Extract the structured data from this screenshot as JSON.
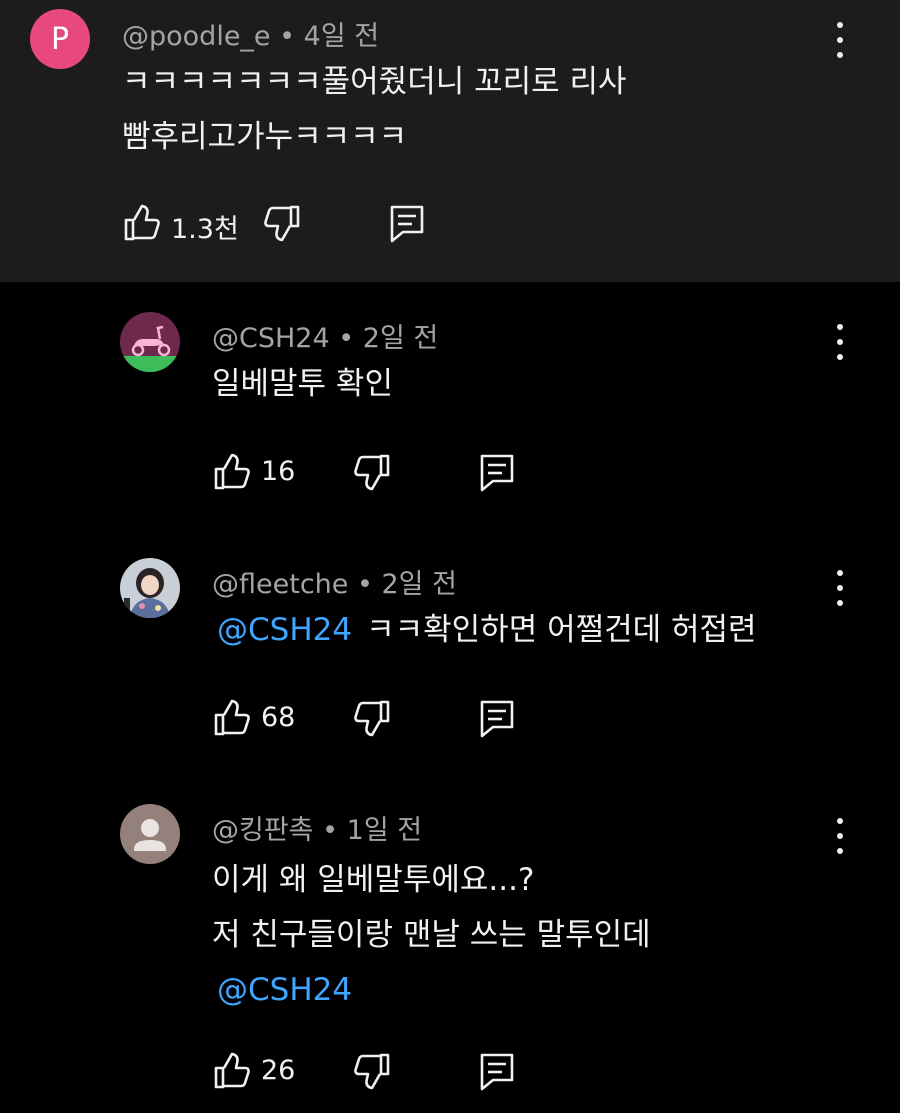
{
  "comments": [
    {
      "handle": "@poodle_e",
      "age": "4일 전",
      "avatar_letter": "P",
      "lines": [
        "ㅋㅋㅋㅋㅋㅋㅋ풀어줬더니 꼬리로 리사",
        "빰후리고가누ㅋㅋㅋㅋ"
      ],
      "likes": "1.3천"
    },
    {
      "handle": "@CSH24",
      "age": "2일 전",
      "lines": [
        "일베말투 확인"
      ],
      "likes": "16"
    },
    {
      "handle": "@fleetche",
      "age": "2일 전",
      "mention": "@CSH24",
      "lines": [
        "ㅋㅋ확인하면 어쩔건데 허접련"
      ],
      "likes": "68"
    },
    {
      "handle": "@킹판촉",
      "age": "1일 전",
      "lines": [
        "이게 왜 일베말투에요...?",
        "저 친구들이랑 맨날 쓰는 말투인데"
      ],
      "mention": "@CSH24",
      "likes": "26"
    }
  ],
  "colors": {
    "top_bg": "#1c1c1c",
    "page_bg": "#000000",
    "mention": "#3ea6ff",
    "meta": "#a4a4a4",
    "avatar_p": "#e8497c"
  },
  "icons": [
    "like-icon",
    "dislike-icon",
    "reply-icon",
    "more-options-icon"
  ]
}
